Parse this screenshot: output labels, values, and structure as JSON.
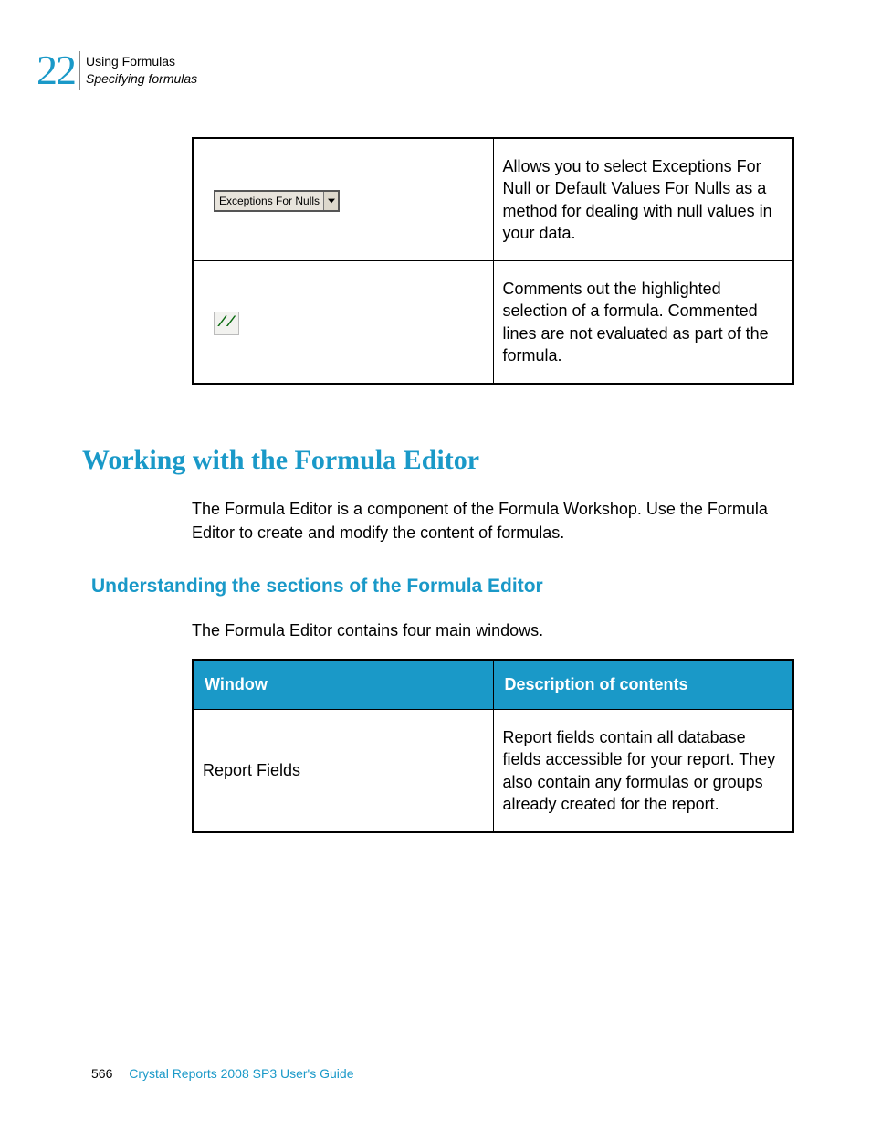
{
  "header": {
    "chapter_number": "22",
    "line1": "Using Formulas",
    "line2": "Specifying formulas"
  },
  "table1": {
    "row1": {
      "dropdown_text": "Exceptions For Nulls",
      "desc": "Allows you to select Exceptions For Null or Default Values For Nulls as a method for dealing with null values in your data."
    },
    "row2": {
      "icon_text": "//",
      "desc": "Comments out the highlighted selection of a formula. Commented lines are not evaluated as part of the formula."
    }
  },
  "section_title": "Working with the Formula Editor",
  "section_body": "The Formula Editor is a component of the Formula Workshop. Use the Formula Editor to create and modify the content of formulas.",
  "sub_title": "Understanding the sections of the Formula Editor",
  "sub_body": "The Formula Editor contains four main windows.",
  "table2": {
    "header_left": "Window",
    "header_right": "Description of contents",
    "row1": {
      "left": "Report Fields",
      "right": "Report fields contain all database fields accessible for your report. They also contain any formulas or groups already created for the report."
    }
  },
  "footer": {
    "page_number": "566",
    "doc_title": "Crystal Reports 2008 SP3 User's Guide"
  }
}
